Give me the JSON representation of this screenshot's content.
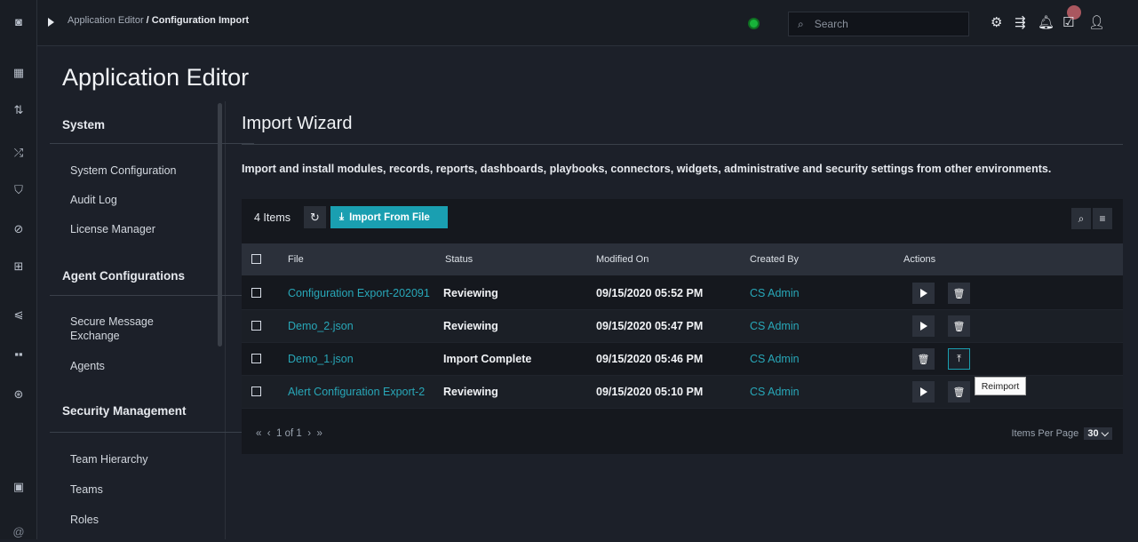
{
  "rail": {
    "icons": [
      "app-icon",
      "dashboard-icon",
      "sort-icon",
      "shuffle-icon",
      "shield-icon",
      "speed-icon",
      "briefcase-icon",
      "chart-icon",
      "grid-icon",
      "help-icon",
      "clipboard-icon",
      "at-icon"
    ],
    "glyphs": [
      "◙",
      "▦",
      "⇅",
      "⤮",
      "⛉",
      "⊘",
      "⊞",
      "⩿",
      "▪▪",
      "⊛",
      "▣",
      "@"
    ]
  },
  "topbar": {
    "breadcrumb_parent": "Application Editor",
    "breadcrumb_sep": "/",
    "breadcrumb_current": "Configuration Import",
    "search_placeholder": "Search",
    "icons": [
      "gear-icon",
      "transfer-icon",
      "bell-icon",
      "clipboard-check-icon",
      "user-icon"
    ],
    "glyphs": [
      "⚙",
      "⇶",
      "🔔︎",
      "☑",
      "👤︎"
    ]
  },
  "page_title": "Application Editor",
  "sidebar": {
    "sections": [
      {
        "title": "System",
        "items": [
          "System Configuration",
          "Audit Log",
          "License Manager"
        ]
      },
      {
        "title": "Agent Configurations",
        "items": [
          "Secure Message Exchange",
          "Agents"
        ]
      },
      {
        "title": "Security Management",
        "items": [
          "Team Hierarchy",
          "Teams",
          "Roles"
        ]
      }
    ]
  },
  "main": {
    "heading": "Import Wizard",
    "description": "Import and install modules, records, reports, dashboards, playbooks, connectors, widgets, administrative and security settings from other environments."
  },
  "grid": {
    "item_count": "4 Items",
    "import_button": "Import From File",
    "columns": [
      "File",
      "Status",
      "Modified On",
      "Created By",
      "Actions"
    ],
    "rows": [
      {
        "file": "Configuration Export-202091",
        "status": "Reviewing",
        "modified": "09/15/2020 05:52 PM",
        "created_by": "CS Admin",
        "actions": [
          "run",
          "delete"
        ]
      },
      {
        "file": "Demo_2.json",
        "status": "Reviewing",
        "modified": "09/15/2020 05:47 PM",
        "created_by": "CS Admin",
        "actions": [
          "run",
          "delete"
        ]
      },
      {
        "file": "Demo_1.json",
        "status": "Import Complete",
        "modified": "09/15/2020 05:46 PM",
        "created_by": "CS Admin",
        "actions": [
          "delete",
          "reimport"
        ]
      },
      {
        "file": "Alert Configuration Export-2",
        "status": "Reviewing",
        "modified": "09/15/2020 05:10 PM",
        "created_by": "CS Admin",
        "actions": [
          "run",
          "delete"
        ]
      }
    ],
    "tooltip": "Reimport",
    "pagination": {
      "first": "«",
      "prev": "‹",
      "page_info": "1 of 1",
      "next": "›",
      "last": "»"
    },
    "items_per_page_label": "Items Per Page",
    "items_per_page_value": "30"
  },
  "colors": {
    "accent": "#1a9fb1",
    "link": "#28a7b8",
    "status_green": "#18b33a"
  }
}
